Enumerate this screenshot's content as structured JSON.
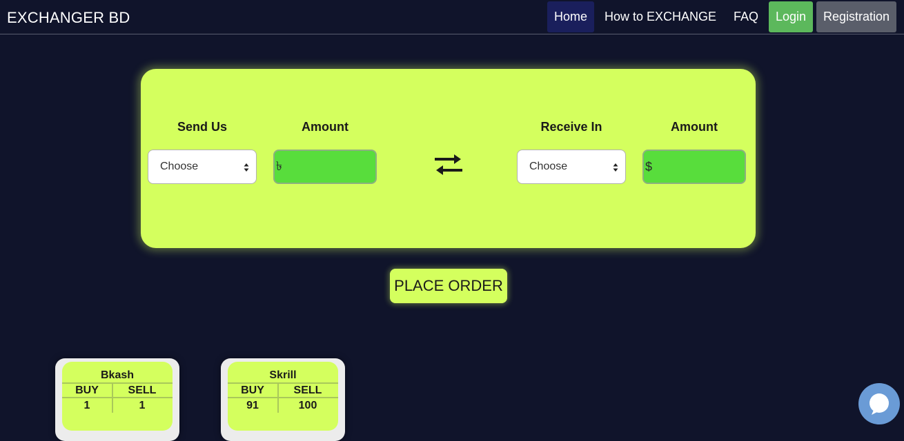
{
  "navbar": {
    "brand": "EXCHANGER BD",
    "items": [
      {
        "label": "Home"
      },
      {
        "label": "How to EXCHANGE"
      },
      {
        "label": "FAQ"
      },
      {
        "label": "Login"
      },
      {
        "label": "Registration"
      }
    ]
  },
  "exchange": {
    "send_label": "Send Us",
    "send_amount_label": "Amount",
    "receive_label": "Receive In",
    "receive_amount_label": "Amount",
    "send_select_value": "Choose",
    "receive_select_value": "Choose",
    "send_currency_symbol": "৳",
    "receive_currency_symbol": "$",
    "swap_icon": "swap-arrows-icon"
  },
  "place_order_label": "PLACE ORDER",
  "rates": [
    {
      "name": "Bkash",
      "buy_label": "BUY",
      "sell_label": "SELL",
      "buy": "1",
      "sell": "1"
    },
    {
      "name": "Skrill",
      "buy_label": "BUY",
      "sell_label": "SELL",
      "buy": "91",
      "sell": "100"
    }
  ],
  "chat_icon": "chat-bubble-icon",
  "colors": {
    "background": "#10142b",
    "accent": "#d4ff5e",
    "amount_field": "#58dd3c",
    "login": "#5cb85c",
    "registration": "#5a5e6a",
    "home_active": "#1a1f5c",
    "chat": "#6a9bd6"
  }
}
